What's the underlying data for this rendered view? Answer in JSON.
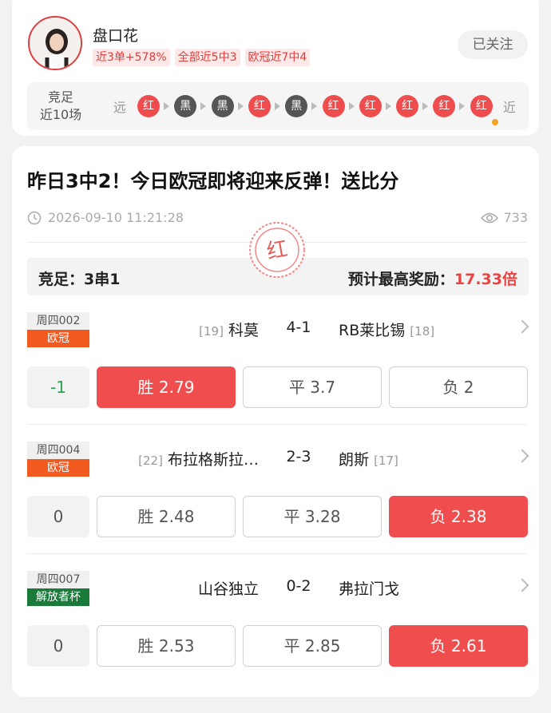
{
  "expert": {
    "name": "盘口花",
    "tags": [
      "近3单+578%",
      "全部近5中3",
      "欧冠近7中4"
    ],
    "follow_label": "已关注",
    "recent": {
      "title_line1": "竞足",
      "title_line2": "近10场",
      "far_label": "远",
      "near_label": "近",
      "results": [
        "红",
        "黑",
        "黑",
        "红",
        "黑",
        "红",
        "红",
        "红",
        "红",
        "红"
      ]
    }
  },
  "article": {
    "title": "昨日3中2！今日欧冠即将迎来反弹！送比分",
    "datetime": "2026-09-10 11:21:28",
    "views": "733",
    "stamp_text": "红",
    "plan_type": "竞足：3串1",
    "reward_label": "预计最高奖励：",
    "reward_value": "17.33倍"
  },
  "matches": [
    {
      "code": "周四002",
      "league": "欧冠",
      "league_color": "#f25a1f",
      "home_rank": "[19]",
      "home": "科莫",
      "score": "4-1",
      "away": "RB莱比锡",
      "away_rank": "[18]",
      "handicap": "-1",
      "options": [
        {
          "label": "胜 2.79",
          "selected": true
        },
        {
          "label": "平 3.7",
          "selected": false
        },
        {
          "label": "负 2",
          "selected": false
        }
      ]
    },
    {
      "code": "周四004",
      "league": "欧冠",
      "league_color": "#f25a1f",
      "home_rank": "[22]",
      "home": "布拉格斯拉…",
      "score": "2-3",
      "away": "朗斯",
      "away_rank": "[17]",
      "handicap": "0",
      "options": [
        {
          "label": "胜 2.48",
          "selected": false
        },
        {
          "label": "平 3.28",
          "selected": false
        },
        {
          "label": "负 2.38",
          "selected": true
        }
      ]
    },
    {
      "code": "周四007",
      "league": "解放者杯",
      "league_color": "#1a7a3a",
      "home_rank": "",
      "home": "山谷独立",
      "score": "0-2",
      "away": "弗拉门戈",
      "away_rank": "",
      "handicap": "0",
      "options": [
        {
          "label": "胜 2.53",
          "selected": false
        },
        {
          "label": "平 2.85",
          "selected": false
        },
        {
          "label": "负 2.61",
          "selected": true
        }
      ]
    }
  ],
  "colors": {
    "accent_red": "#f04e4e",
    "result_black": "#555555",
    "win_green": "#2ba24c"
  }
}
